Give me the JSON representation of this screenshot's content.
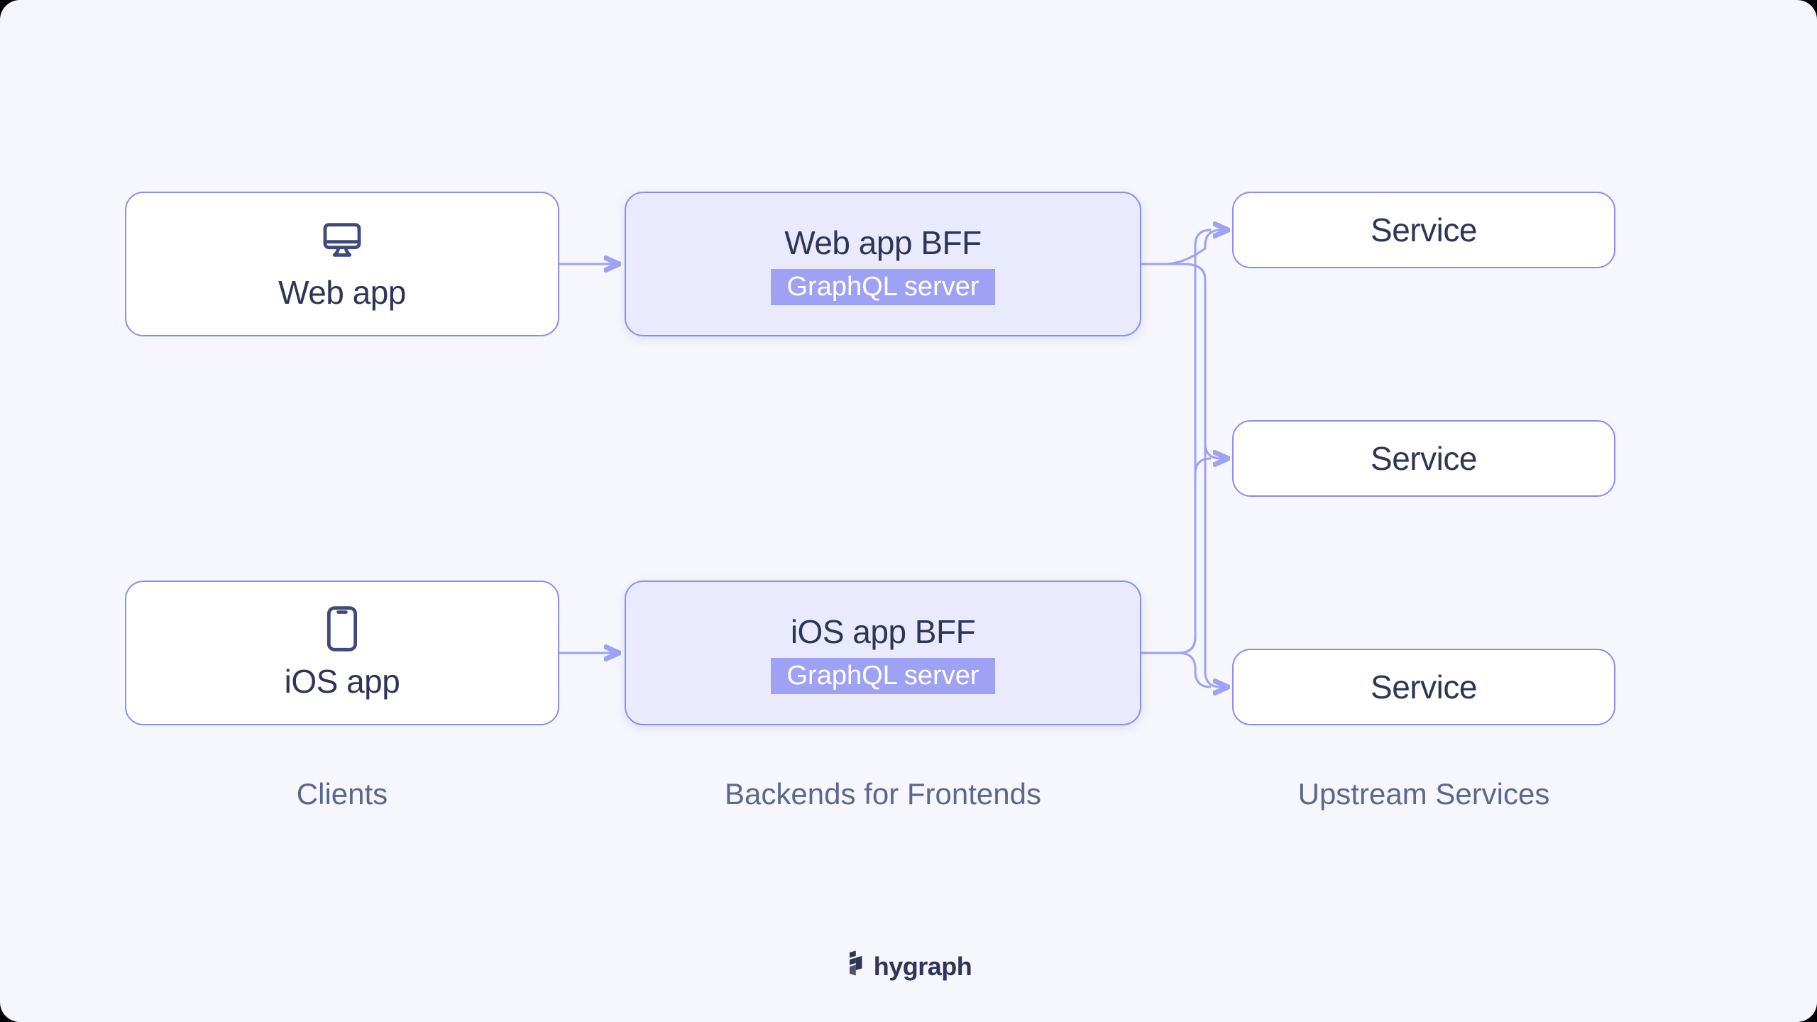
{
  "columns": {
    "clients_label": "Clients",
    "bff_label": "Backends for Frontends",
    "services_label": "Upstream Services"
  },
  "clients": {
    "web": {
      "label": "Web app",
      "icon": "desktop"
    },
    "ios": {
      "label": "iOS app",
      "icon": "mobile"
    }
  },
  "bffs": {
    "web": {
      "title": "Web app BFF",
      "subtitle": "GraphQL server"
    },
    "ios": {
      "title": "iOS app BFF",
      "subtitle": "GraphQL server"
    }
  },
  "services": {
    "a": {
      "label": "Service"
    },
    "b": {
      "label": "Service"
    },
    "c": {
      "label": "Service"
    }
  },
  "brand": {
    "name": "hygraph"
  },
  "colors": {
    "background": "#F5F7FC",
    "box_border": "#8B8CF2",
    "bff_fill": "#E9EAFD",
    "badge_fill": "#9FA1F4",
    "text_primary": "#2E3555",
    "text_secondary": "#5C668E",
    "connector": "#9FA1F4"
  }
}
